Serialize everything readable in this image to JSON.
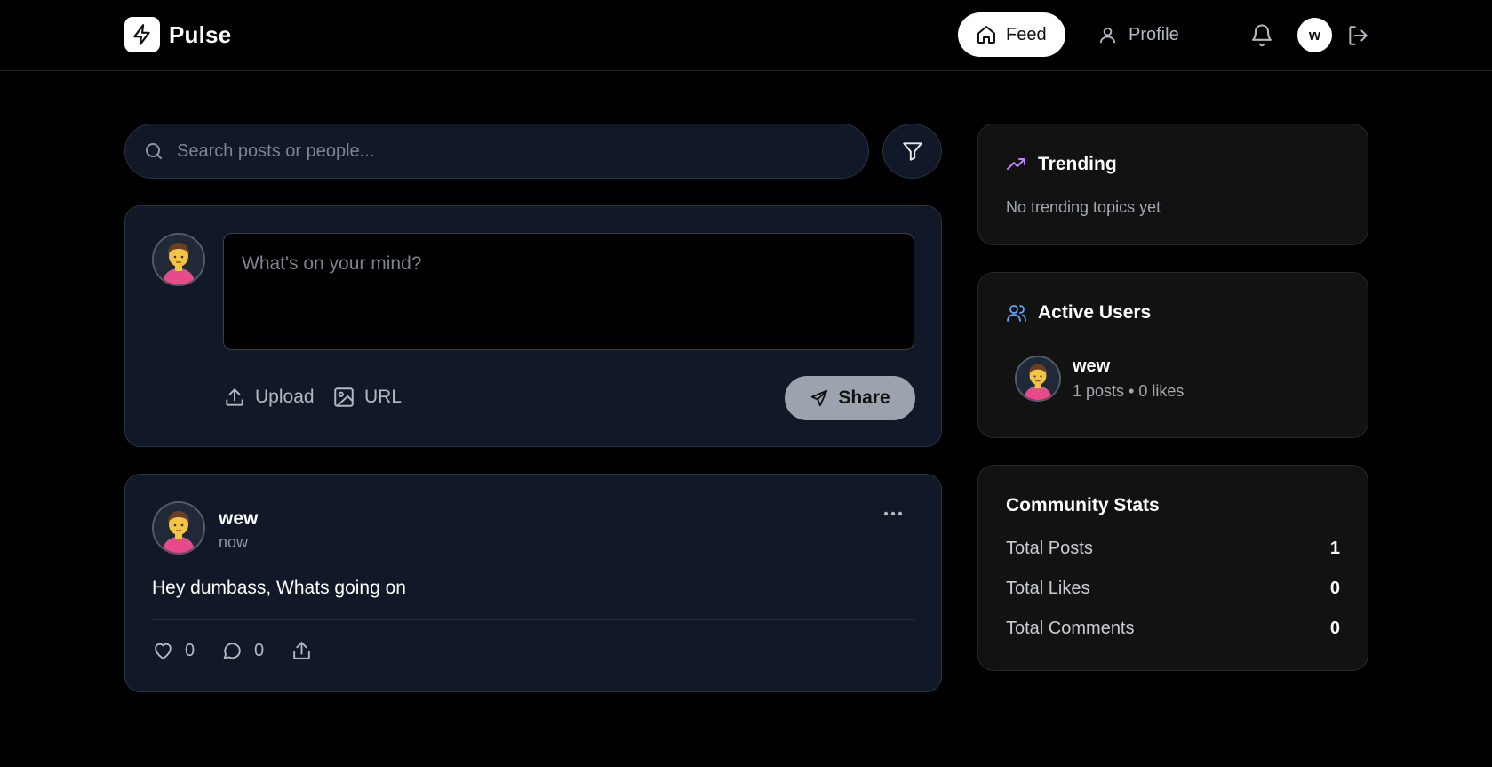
{
  "header": {
    "brand": "Pulse",
    "nav": {
      "feed_label": "Feed",
      "profile_label": "Profile"
    },
    "user_initial": "w"
  },
  "search": {
    "placeholder": "Search posts or people..."
  },
  "composer": {
    "placeholder": "What's on your mind?",
    "upload_label": "Upload",
    "url_label": "URL",
    "share_label": "Share"
  },
  "posts": [
    {
      "author": "wew",
      "time": "now",
      "text": "Hey dumbass, Whats going on",
      "likes": "0",
      "comments": "0"
    }
  ],
  "sidebar": {
    "trending": {
      "title": "Trending",
      "empty_text": "No trending topics yet"
    },
    "active_users": {
      "title": "Active Users",
      "users": [
        {
          "name": "wew",
          "meta": "1 posts • 0 likes"
        }
      ]
    },
    "community_stats": {
      "title": "Community Stats",
      "rows": [
        {
          "label": "Total Posts",
          "value": "1"
        },
        {
          "label": "Total Likes",
          "value": "0"
        },
        {
          "label": "Total Comments",
          "value": "0"
        }
      ]
    }
  },
  "colors": {
    "page_bg": "#000000",
    "card_bg": "#111827",
    "sidebar_bg": "#121212",
    "trending_accent": "#c084fc",
    "users_accent": "#60a5fa",
    "share_button": "#9ca3af"
  },
  "icons": [
    "zap-icon",
    "home-icon",
    "user-icon",
    "bell-icon",
    "logout-icon",
    "search-icon",
    "filter-icon",
    "upload-icon",
    "image-icon",
    "send-icon",
    "more-icon",
    "heart-icon",
    "comment-icon",
    "share-icon",
    "trending-icon",
    "users-icon"
  ]
}
